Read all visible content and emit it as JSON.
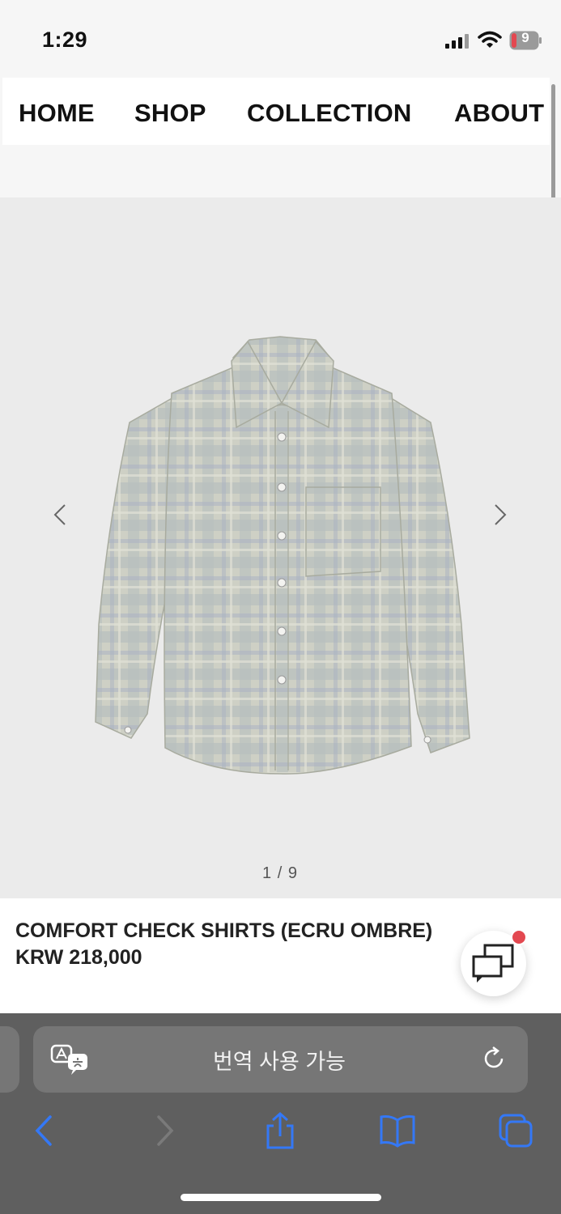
{
  "status": {
    "time": "1:29",
    "battery": "9"
  },
  "nav": {
    "items": [
      "HOME",
      "SHOP",
      "COLLECTION",
      "ABOUT"
    ]
  },
  "gallery": {
    "counter": "1 / 9",
    "image": "plaid-shirt-image"
  },
  "product": {
    "name": "COMFORT CHECK SHIRTS (ECRU OMBRE)",
    "price": "KRW 218,000"
  },
  "browser": {
    "address_text": "번역 사용 가능"
  },
  "colors": {
    "accent": "#3478f6",
    "notification": "#e34850",
    "toolbar": "#5f5f5f"
  }
}
